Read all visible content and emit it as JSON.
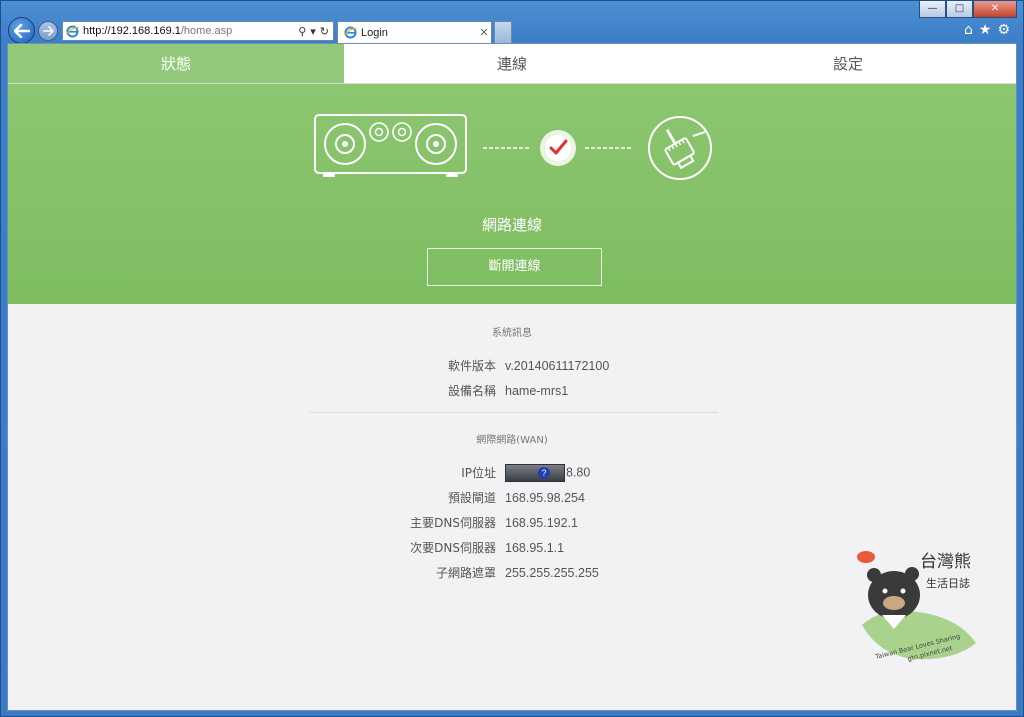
{
  "browser": {
    "window_controls": [
      "—",
      "□",
      "✕"
    ],
    "address": {
      "host": "http://192.168.169.1",
      "path": "/home.asp"
    },
    "tab": {
      "title": "Login"
    }
  },
  "app": {
    "nav": [
      {
        "label": "狀態",
        "active": true
      },
      {
        "label": "連線",
        "active": false
      },
      {
        "label": "設定",
        "active": false
      }
    ],
    "hero": {
      "status_title": "網路連線",
      "disconnect_label": "斷開連線",
      "accent": "#7dbd60"
    },
    "system": {
      "title": "系統訊息",
      "rows": [
        {
          "k": "軟件版本",
          "v": "v.20140611172100"
        },
        {
          "k": "設備名稱",
          "v": "hame-mrs1"
        }
      ]
    },
    "wan": {
      "title": "網際網路(WAN)",
      "ip_label": "IP位址",
      "ip_value_suffix": "8.80",
      "rows": [
        {
          "k": "預設閘道",
          "v": "168.95.98.254"
        },
        {
          "k": "主要DNS伺服器",
          "v": "168.95.192.1"
        },
        {
          "k": "次要DNS伺服器",
          "v": "168.95.1.1"
        },
        {
          "k": "子網路遮罩",
          "v": "255.255.255.255"
        }
      ]
    },
    "watermark": {
      "brand": "台灣熊",
      "tagline": "生活日誌",
      "caption": "Taiwan Bear Loves Sharing",
      "url": "gtn.pixnet.net"
    }
  }
}
